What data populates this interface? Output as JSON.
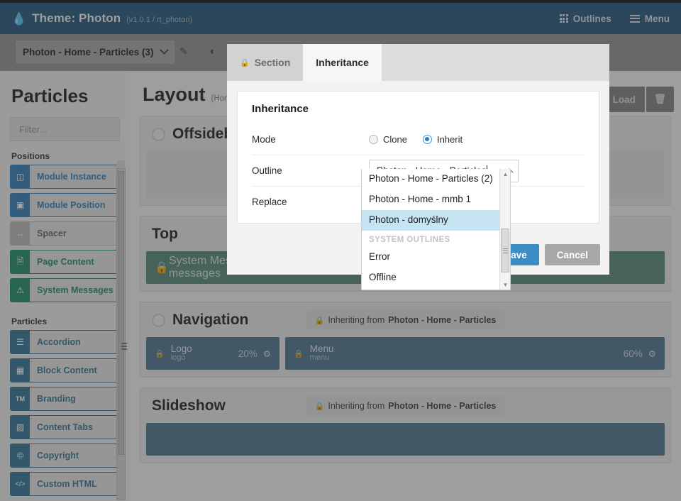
{
  "header": {
    "drop_icon": "drop-icon",
    "title": "Theme: Photon",
    "subtitle": "(v1.0.1 / rt_photon)",
    "outlines_label": "Outlines",
    "menu_label": "Menu",
    "bg": "#1e5077"
  },
  "toolbar": {
    "outline_name": "Photon - Home - Particles (3)",
    "pencil_icon": "pencil-icon",
    "contrast_icon": "contrast-icon",
    "load_label": "Load",
    "branch_icon": "branch-icon",
    "trash_icon": "trash-icon"
  },
  "sidebar": {
    "title": "Particles",
    "filter_placeholder": "Filter...",
    "filter_value": "",
    "groups": [
      {
        "label": "Positions",
        "items": [
          {
            "label": "Module Instance",
            "icon": "module-instance-icon",
            "glyph": "❐",
            "color": "blue"
          },
          {
            "label": "Module Position",
            "icon": "module-position-icon",
            "glyph": "▣",
            "color": "blue"
          },
          {
            "label": "Spacer",
            "icon": "spacer-icon",
            "glyph": "↔",
            "color": "gray"
          },
          {
            "label": "Page Content",
            "icon": "page-content-icon",
            "glyph": "὜b",
            "color": "green"
          },
          {
            "label": "System Messages",
            "icon": "system-messages-icon",
            "glyph": "ⓘ",
            "color": "green"
          }
        ]
      },
      {
        "label": "Particles",
        "items": [
          {
            "label": "Accordion",
            "icon": "accordion-icon",
            "glyph": "≣",
            "color": "navy"
          },
          {
            "label": "Block Content",
            "icon": "block-content-icon",
            "glyph": "⊞",
            "color": "navy"
          },
          {
            "label": "Branding",
            "icon": "branding-icon",
            "glyph": "TM",
            "color": "navy"
          },
          {
            "label": "Content Tabs",
            "icon": "content-tabs-icon",
            "glyph": "⌸",
            "color": "navy"
          },
          {
            "label": "Copyright",
            "icon": "copyright-icon",
            "glyph": "©",
            "color": "navy"
          },
          {
            "label": "Custom HTML",
            "icon": "custom-html-icon",
            "glyph": "‹›",
            "color": "navy"
          }
        ]
      }
    ]
  },
  "main": {
    "page_title": "Layout",
    "page_subtitle": "(Hom",
    "sections": [
      {
        "name": "Offsideb",
        "inherit_text": "",
        "inherit_from": "",
        "particles": []
      },
      {
        "name": "Top",
        "inherit_text": "",
        "inherit_from": "",
        "particles": [
          {
            "name": "System Messages",
            "key": "messages",
            "pct": "",
            "style": "green"
          }
        ]
      },
      {
        "name": "Navigation",
        "inherit_text": "Inheriting from",
        "inherit_from": "Photon - Home - Particles",
        "particles": [
          {
            "name": "Logo",
            "key": "logo",
            "pct": "20%",
            "style": "blue"
          },
          {
            "name": "Menu",
            "key": "menu",
            "pct": "60%",
            "style": "blue"
          }
        ]
      },
      {
        "name": "Slideshow",
        "inherit_text": "Inheriting from",
        "inherit_from": "Photon - Home - Particles",
        "particles": []
      }
    ]
  },
  "modal": {
    "tabs": [
      {
        "label": "Section",
        "icon": "lock-icon",
        "selected": false,
        "locked": true
      },
      {
        "label": "Inheritance",
        "icon": "",
        "selected": true,
        "locked": false
      }
    ],
    "panel_title": "Inheritance",
    "mode": {
      "label": "Mode",
      "options": [
        {
          "label": "Clone",
          "selected": false
        },
        {
          "label": "Inherit",
          "selected": true
        }
      ]
    },
    "outline": {
      "label": "Outline",
      "value": "Photon - Home - Particles",
      "expanded": true,
      "chevron_icon": "chevron-up-icon",
      "options": [
        {
          "label": "Photon - Home - Particles (2)",
          "highlighted": false,
          "group": false
        },
        {
          "label": "Photon - Home - mmb 1",
          "highlighted": false,
          "group": false
        },
        {
          "label": "Photon - domyślny",
          "highlighted": true,
          "group": false
        },
        {
          "label": "SYSTEM OUTLINES",
          "highlighted": false,
          "group": true
        },
        {
          "label": "Error",
          "highlighted": false,
          "group": false
        },
        {
          "label": "Offline",
          "highlighted": false,
          "group": false
        }
      ]
    },
    "replace": {
      "label": "Replace"
    },
    "save_label": "Save",
    "cancel_label": "Cancel",
    "accent": "#3c8dc5"
  }
}
